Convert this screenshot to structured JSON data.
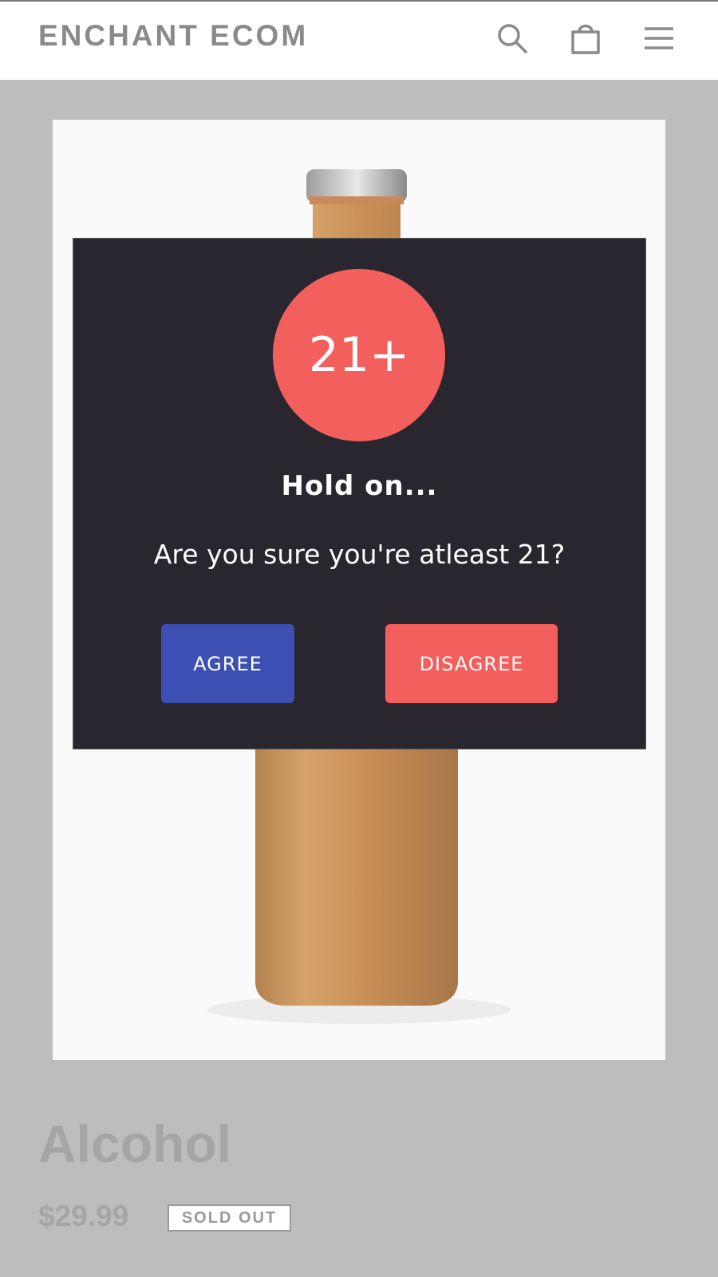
{
  "header": {
    "brand": "ENCHANT ECOM",
    "icons": [
      "search-icon",
      "shopping-bag-icon",
      "menu-icon"
    ]
  },
  "product": {
    "image_icon": "beer-bottle",
    "title": "Alcohol",
    "price": "$29.99",
    "badge": "SOLD OUT"
  },
  "age_gate": {
    "badge": "21+",
    "title": "Hold on...",
    "message": "Are you sure you're atleast 21?",
    "agree_label": "AGREE",
    "disagree_label": "DISAGREE"
  },
  "colors": {
    "overlay": "#bdbdbd",
    "modal_background": "#2a2630",
    "accent_red": "#f25f5c",
    "accent_blue": "#3d4fb3"
  }
}
